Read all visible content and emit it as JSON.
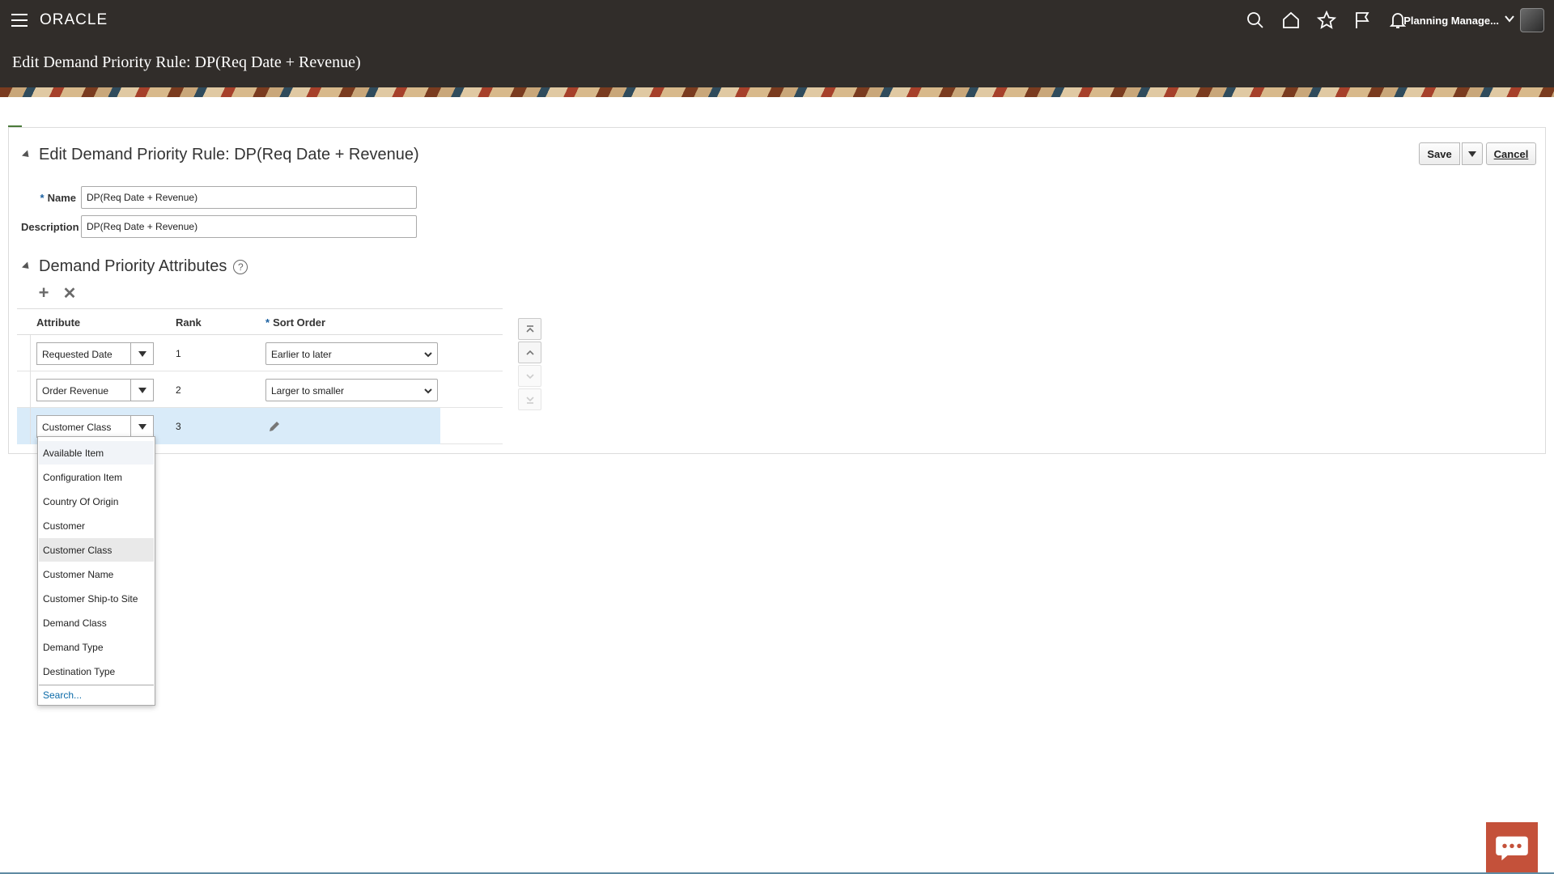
{
  "header": {
    "logo": "ORACLE",
    "user_name": "Planning Manage...",
    "page_heading": "Edit Demand Priority Rule: DP(Req Date + Revenue)"
  },
  "panel": {
    "title": "Edit Demand Priority Rule: DP(Req Date + Revenue)",
    "save_label": "Save",
    "cancel_label": "Cancel",
    "name_label": "Name",
    "name_value": "DP(Req Date + Revenue)",
    "description_label": "Description",
    "description_value": "DP(Req Date + Revenue)",
    "required_marker": "*"
  },
  "attributes_section": {
    "title": "Demand Priority Attributes",
    "help_glyph": "?",
    "columns": {
      "attribute": "Attribute",
      "rank": "Rank",
      "sort_order": "Sort Order"
    },
    "rows": [
      {
        "attribute": "Requested Date",
        "rank": "1",
        "sort_order": "Earlier to later"
      },
      {
        "attribute": "Order Revenue",
        "rank": "2",
        "sort_order": "Larger to smaller"
      },
      {
        "attribute": "Customer Class",
        "rank": "3",
        "sort_order": ""
      }
    ]
  },
  "attribute_dropdown": {
    "options": [
      "Available Item",
      "Configuration Item",
      "Country Of Origin",
      "Customer",
      "Customer Class",
      "Customer Name",
      "Customer Ship-to Site",
      "Demand Class",
      "Demand Type",
      "Destination Type"
    ],
    "selected": "Customer Class",
    "search_label": "Search..."
  },
  "colors": {
    "topbar": "#312d2a",
    "selected_row": "#d9ebf9",
    "link": "#0a6aa8",
    "chat_button": "#c4513a"
  }
}
